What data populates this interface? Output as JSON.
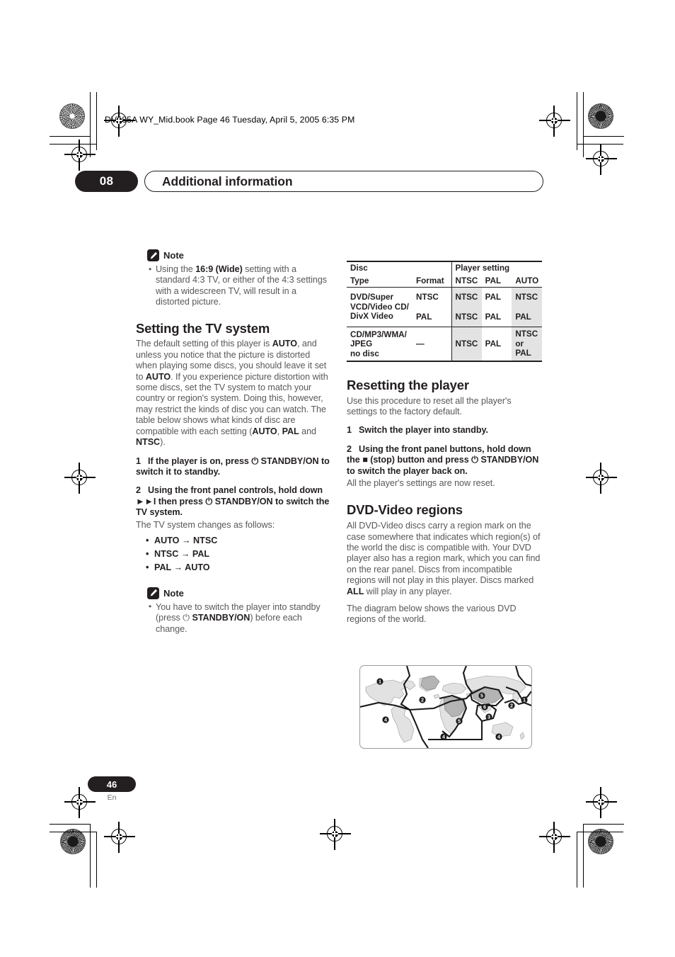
{
  "slug": "DV585A WY_Mid.book  Page 46  Tuesday, April 5, 2005  6:35 PM",
  "header": {
    "chapter_number": "08",
    "chapter_title": "Additional information"
  },
  "left_column": {
    "note1": {
      "label": "Note",
      "icon": "pencil-icon",
      "items": [
        "Using the 16:9 (Wide) setting with a standard 4:3 TV, or either of the 4:3 settings with a widescreen TV, will result in a distorted picture."
      ]
    },
    "section_tv_system": {
      "heading": "Setting the TV system",
      "body": "The default setting of this player is AUTO, and unless you notice that the picture is distorted when playing some discs, you should leave it set to AUTO. If you experience picture distortion with some discs, set the TV system to match your country or region's system. Doing this, however, may restrict the kinds of disc you can watch. The table below shows what kinds of disc are compatible with each setting (AUTO, PAL and NTSC).",
      "step1": "1    If the player is on, press ⏻ STANDBY/ON to switch it to standby.",
      "step2": "2    Using the front panel controls, hold down ►►I then press ⏻ STANDBY/ON to switch the TV system.",
      "step2_note": "The TV system changes as follows:",
      "transitions": [
        "AUTO → NTSC",
        "NTSC → PAL",
        "PAL → AUTO"
      ]
    },
    "note2": {
      "label": "Note",
      "icon": "pencil-icon",
      "items": [
        "You have to switch the player into standby (press ⏻ STANDBY/ON) before each change."
      ]
    }
  },
  "right_column": {
    "table": {
      "header_row1": [
        "Disc",
        "",
        "Player setting"
      ],
      "header_row2": [
        "Type",
        "Format",
        "NTSC",
        "PAL",
        "AUTO"
      ],
      "rows": [
        {
          "type": "DVD/Super VCD/Video CD/ DivX Video",
          "formats": [
            {
              "format": "NTSC",
              "ntsc": "NTSC",
              "pal": "PAL",
              "auto": "NTSC"
            },
            {
              "format": "PAL",
              "ntsc": "NTSC",
              "pal": "PAL",
              "auto": "PAL"
            }
          ]
        },
        {
          "type": "CD/MP3/WMA/ JPEG no disc",
          "formats": [
            {
              "format": "—",
              "ntsc": "NTSC",
              "pal": "PAL",
              "auto": "NTSC or PAL"
            }
          ]
        }
      ],
      "shaded_columns": [
        "NTSC",
        "AUTO"
      ],
      "shade_color": "#e3e3e3"
    },
    "section_reset": {
      "heading": "Resetting the player",
      "body": "Use this procedure to reset all the player's settings to the factory default.",
      "step1": "1    Switch the player into standby.",
      "step2": "2    Using the front panel buttons, hold down the ■ (stop) button and press ⏻ STANDBY/ON to switch the player back on.",
      "step2_after": "All the player's settings are now reset."
    },
    "section_regions": {
      "heading": "DVD-Video regions",
      "body1": "All DVD-Video discs carry a region mark on the case somewhere that indicates which region(s) of the world the disc is compatible with. Your DVD player also has a region mark, which you can find on the rear panel. Discs from incompatible regions will not play in this player. Discs marked ALL will play in any player.",
      "body2": "The diagram below shows the various DVD regions of the world.",
      "map": {
        "name": "dvd-region-world-map",
        "region_labels": [
          "1",
          "2",
          "4",
          "5",
          "6",
          "3",
          "2",
          "1",
          "5",
          "4",
          "4",
          "2"
        ]
      }
    }
  },
  "footer": {
    "page_number": "46",
    "language": "En"
  },
  "colors": {
    "ink": "#231f20",
    "body_text": "#58585a",
    "table_shade": "#e3e3e3",
    "map_land": "#e0e0e0",
    "map_land_dark": "#b5b5b5"
  }
}
